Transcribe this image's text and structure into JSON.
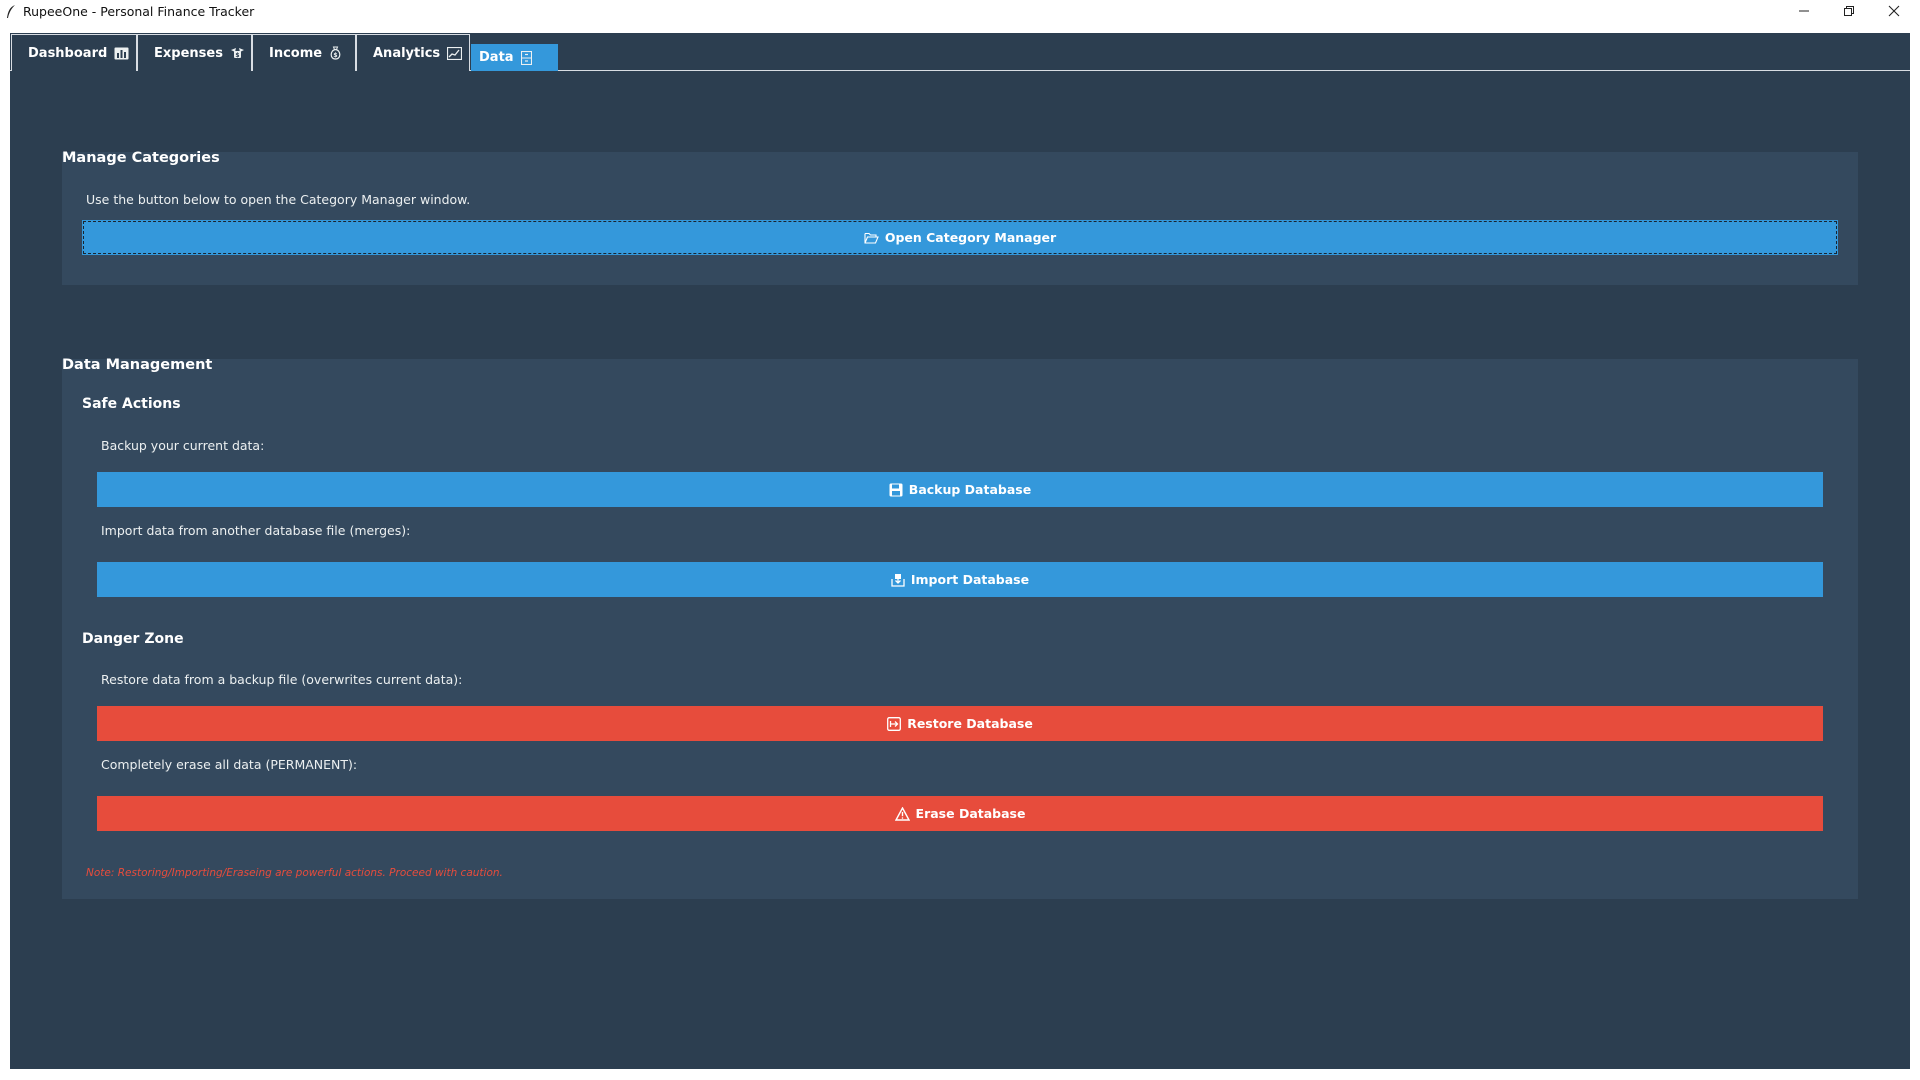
{
  "window": {
    "title": "RupeeOne - Personal Finance Tracker"
  },
  "tabs": [
    {
      "label": "Dashboard",
      "icon": "chart-icon"
    },
    {
      "label": "Expenses",
      "icon": "money-wings-icon"
    },
    {
      "label": "Income",
      "icon": "money-bag-icon"
    },
    {
      "label": "Analytics",
      "icon": "chart-increasing-icon"
    },
    {
      "label": "Data",
      "icon": "file-cabinet-icon",
      "active": true
    }
  ],
  "categories": {
    "title": "Manage Categories",
    "description": "Use the button below to open the Category Manager window.",
    "open_button": "Open Category Manager",
    "open_icon": "open-folder-icon"
  },
  "data_management": {
    "title": "Data Management",
    "safe": {
      "title": "Safe Actions",
      "backup_label": "Backup your current data:",
      "backup_button": "Backup Database",
      "import_label": "Import data from another database file (merges):",
      "import_button": "Import Database"
    },
    "danger": {
      "title": "Danger Zone",
      "restore_label": "Restore data from a backup file (overwrites current data):",
      "restore_button": "Restore Database",
      "erase_label": "Completely erase all data (PERMANENT):",
      "erase_button": "Erase Database"
    },
    "note": "Note: Restoring/Importing/Eraseing are powerful actions. Proceed with caution."
  },
  "colors": {
    "background": "#2c3e50",
    "panel": "#34495e",
    "accent": "#3498db",
    "danger": "#e74c3c"
  }
}
